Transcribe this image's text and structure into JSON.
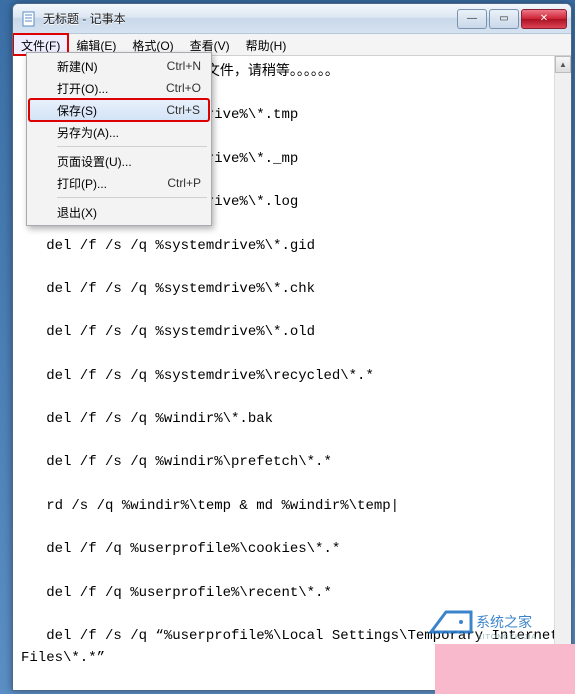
{
  "window": {
    "title": "无标题 - 记事本"
  },
  "menubar": {
    "items": [
      {
        "label": "文件(F)",
        "active": true
      },
      {
        "label": "编辑(E)"
      },
      {
        "label": "格式(O)"
      },
      {
        "label": "查看(V)"
      },
      {
        "label": "帮助(H)"
      }
    ]
  },
  "file_menu": {
    "items": [
      {
        "label": "新建(N)",
        "shortcut": "Ctrl+N"
      },
      {
        "label": "打开(O)...",
        "shortcut": "Ctrl+O"
      },
      {
        "label": "保存(S)",
        "shortcut": "Ctrl+S",
        "highlight": true
      },
      {
        "label": "另存为(A)...",
        "shortcut": ""
      },
      {
        "sep": true
      },
      {
        "label": "页面设置(U)...",
        "shortcut": ""
      },
      {
        "label": "打印(P)...",
        "shortcut": "Ctrl+P"
      },
      {
        "sep": true
      },
      {
        "label": "退出(X)",
        "shortcut": ""
      }
    ]
  },
  "editor": {
    "text": "                      文件，请稍等。。。。。。\n\n                      rive%\\*.tmp\n\n                      rive%\\*._mp\n\n                      rive%\\*.log\n\n   del /f /s /q %systemdrive%\\*.gid\n\n   del /f /s /q %systemdrive%\\*.chk\n\n   del /f /s /q %systemdrive%\\*.old\n\n   del /f /s /q %systemdrive%\\recycled\\*.*\n\n   del /f /s /q %windir%\\*.bak\n\n   del /f /s /q %windir%\\prefetch\\*.*\n\n   rd /s /q %windir%\\temp & md %windir%\\temp|\n\n   del /f /q %userprofile%\\cookies\\*.*\n\n   del /f /q %userprofile%\\recent\\*.*\n\n   del /f /s /q “%userprofile%\\Local Settings\\Temporary Internet\nFiles\\*.*”\n\n   del /f /s /q “%userprofile%\\Local Settings\\Temp\\*.*”\n\n   del /f /s /q “%userprofile%\\recent\\*.*”\n\n   echo 系统垃圾清除完毕!\n\n   echo. & pause"
  },
  "watermark_text": "系统之家"
}
